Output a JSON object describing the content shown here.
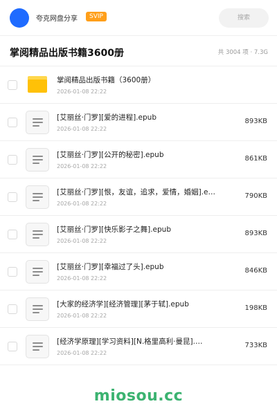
{
  "header": {
    "site_name": "夸克网盘分享",
    "badge": "SVIP",
    "search_placeholder": "搜索",
    "colors": {
      "avatar": "#1f6bff",
      "badge": "#ff9f1a"
    }
  },
  "folder": {
    "title": "掌阅精品出版书籍3600册",
    "meta": "共 3004 项 · 7.3G"
  },
  "items": [
    {
      "type": "folder",
      "icon": "folder-icon",
      "name": "掌阅精品出版书籍（3600册）",
      "date": "2026-01-08 22:22",
      "size": ""
    },
    {
      "type": "file",
      "icon": "file-icon",
      "name": "[艾丽丝·门罗][爱的进程].epub",
      "date": "2026-01-08 22:22",
      "size": "893KB"
    },
    {
      "type": "file",
      "icon": "file-icon",
      "name": "[艾丽丝·门罗][公开的秘密].epub",
      "date": "2026-01-08 22:22",
      "size": "861KB"
    },
    {
      "type": "file",
      "icon": "file-icon",
      "name": "[艾丽丝·门罗][恨，友谊，追求，爱情，婚姻].e…",
      "date": "2026-01-08 22:22",
      "size": "790KB"
    },
    {
      "type": "file",
      "icon": "file-icon",
      "name": "[艾丽丝·门罗][快乐影子之舞].epub",
      "date": "2026-01-08 22:22",
      "size": "893KB"
    },
    {
      "type": "file",
      "icon": "file-icon",
      "name": "[艾丽丝·门罗][幸福过了头].epub",
      "date": "2026-01-08 22:22",
      "size": "846KB"
    },
    {
      "type": "file",
      "icon": "file-icon",
      "name": "[大家的经济学][经济管理][茅于轼].epub",
      "date": "2026-01-08 22:22",
      "size": "198KB"
    },
    {
      "type": "file",
      "icon": "file-icon",
      "name": "[经济学原理][学习资料][N.格里高利·曼昆].…",
      "date": "2026-01-08 22:22",
      "size": "733KB"
    }
  ],
  "footer": {
    "watermark": "miosou.cc",
    "color": "#3cb371"
  }
}
